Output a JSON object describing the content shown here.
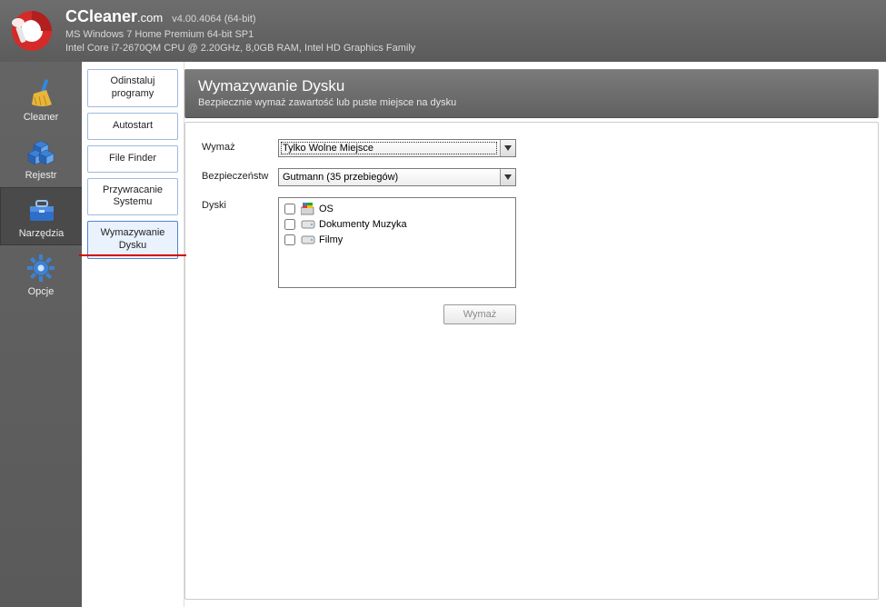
{
  "header": {
    "title_main": "CCleaner",
    "title_suffix": ".com",
    "version": "v4.00.4064 (64-bit)",
    "sys_line1": "MS Windows 7 Home Premium 64-bit SP1",
    "sys_line2": "Intel Core i7-2670QM CPU @ 2.20GHz, 8,0GB RAM, Intel HD Graphics Family"
  },
  "sidebar": {
    "items": [
      {
        "label": "Cleaner"
      },
      {
        "label": "Rejestr"
      },
      {
        "label": "Narzędzia"
      },
      {
        "label": "Opcje"
      }
    ]
  },
  "subnav": {
    "items": [
      {
        "label": "Odinstaluj programy"
      },
      {
        "label": "Autostart"
      },
      {
        "label": "File Finder"
      },
      {
        "label": "Przywracanie Systemu"
      },
      {
        "label": "Wymazywanie Dysku"
      }
    ]
  },
  "main": {
    "title": "Wymazywanie Dysku",
    "subtitle": "Bezpiecznie wymaż zawartość lub puste miejsce na dysku",
    "labels": {
      "wipe": "Wymaż",
      "security": "Bezpieczeństw",
      "drives": "Dyski"
    },
    "wipe_select": "Tylko Wolne Miejsce",
    "security_select": "Gutmann (35 przebiegów)",
    "drives_list": [
      {
        "label": "OS",
        "type": "sys"
      },
      {
        "label": "Dokumenty Muzyka",
        "type": "hdd"
      },
      {
        "label": "Filmy",
        "type": "hdd"
      }
    ],
    "wipe_button": "Wymaż"
  }
}
